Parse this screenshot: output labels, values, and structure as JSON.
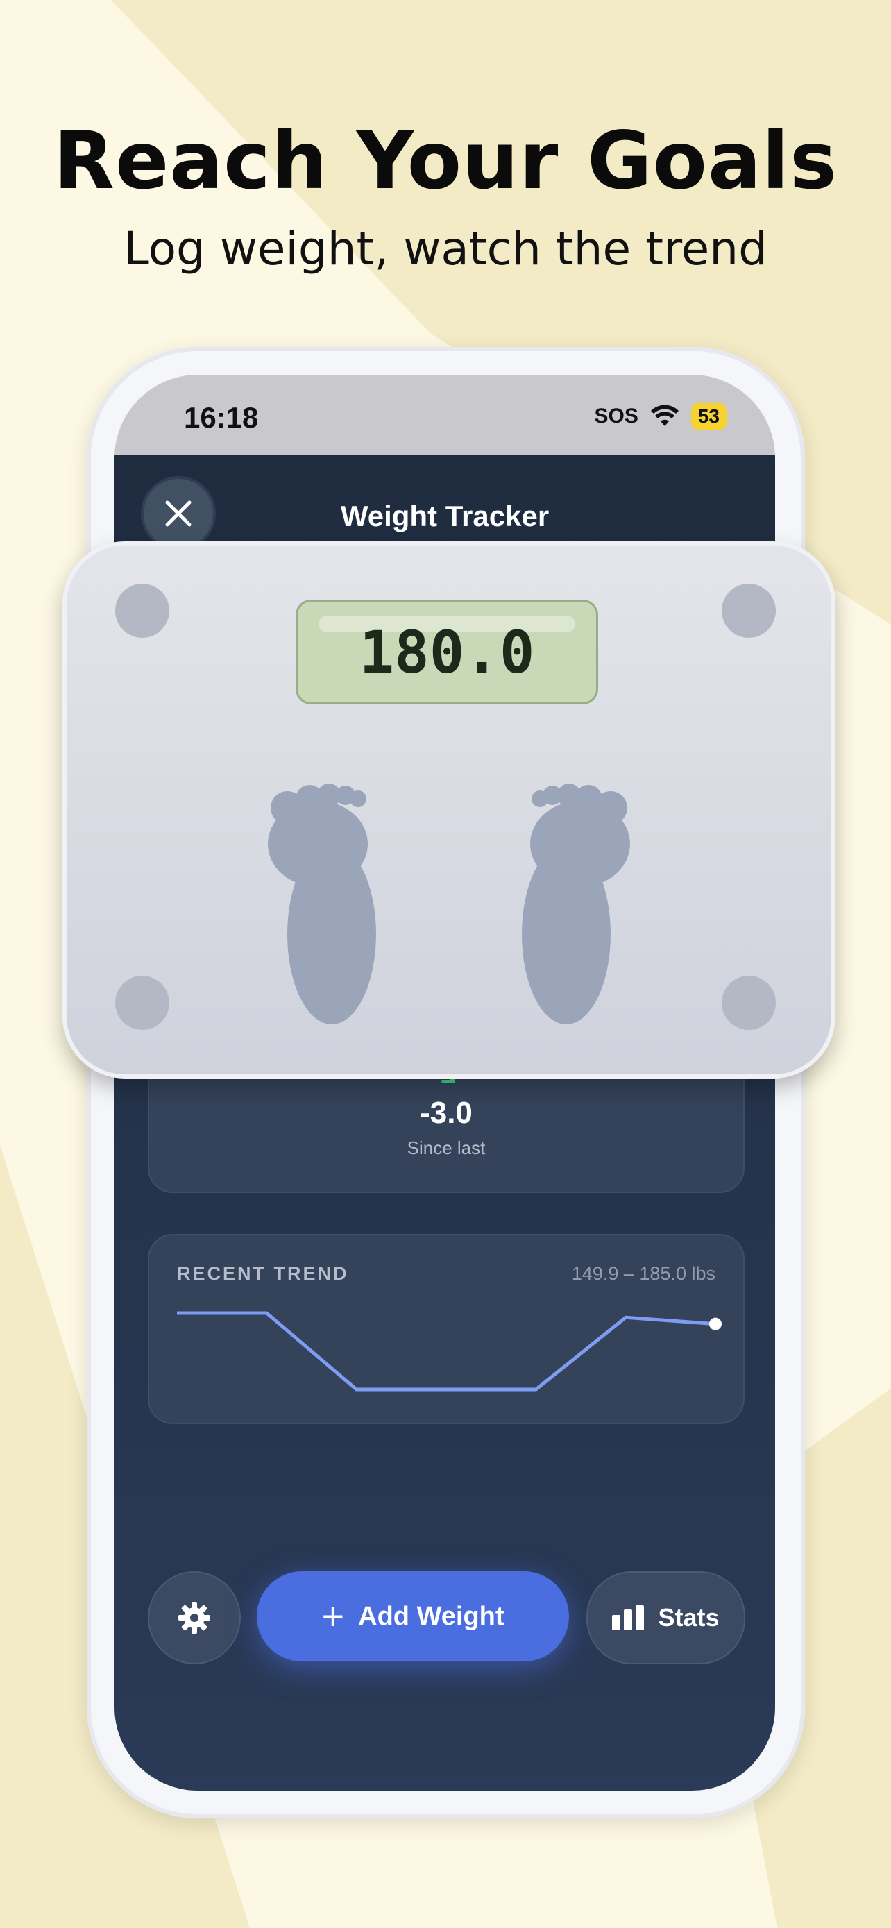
{
  "promo": {
    "headline": "Reach Your Goals",
    "subhead": "Log weight, watch the trend"
  },
  "status_bar": {
    "time": "16:18",
    "sos": "SOS",
    "battery": "53"
  },
  "header": {
    "title": "Weight Tracker",
    "close_icon": "close-icon"
  },
  "scale_display": {
    "value": "180.0"
  },
  "since_last": {
    "value": "-3.0",
    "label": "Since last",
    "arrow_icon": "arrow-down-right-icon",
    "color": "#3fd07a"
  },
  "trend": {
    "title": "RECENT TREND",
    "range": "149.9 – 185.0 lbs",
    "line_color": "#7d9cf2",
    "chart_data": {
      "type": "line",
      "ylim": [
        149.9,
        185.0
      ],
      "values": [
        185.0,
        185.0,
        149.9,
        149.9,
        149.9,
        183.0,
        180.0
      ]
    }
  },
  "actions": {
    "settings_icon": "gear-icon",
    "add_label": "Add Weight",
    "add_icon": "plus-icon",
    "stats_label": "Stats",
    "stats_icon": "bar-chart-icon",
    "accent": "#4a6ee0"
  }
}
